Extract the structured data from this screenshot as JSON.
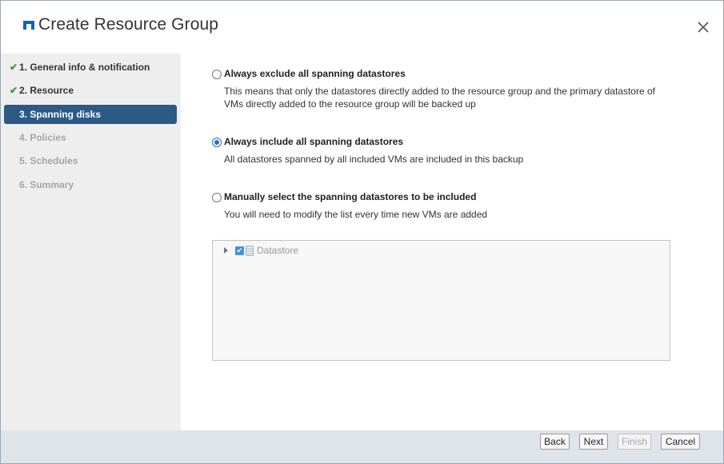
{
  "dialog": {
    "title": "Create Resource Group",
    "logo_icon": "netapp-logo-icon",
    "close_icon": "close-icon",
    "accent_color": "#2b5a87"
  },
  "sidebar": {
    "steps": [
      {
        "label": "1. General info & notification",
        "state": "completed"
      },
      {
        "label": "2. Resource",
        "state": "completed"
      },
      {
        "label": "3. Spanning disks",
        "state": "active"
      },
      {
        "label": "4. Policies",
        "state": "disabled"
      },
      {
        "label": "5. Schedules",
        "state": "disabled"
      },
      {
        "label": "6. Summary",
        "state": "disabled"
      }
    ],
    "check_glyph": "✔"
  },
  "options": [
    {
      "title": "Always exclude all spanning datastores",
      "description": "This means that only the datastores directly added to the resource group and the primary datastore of VMs directly added to the resource group will be backed up",
      "selected": false
    },
    {
      "title": "Always include all spanning datastores",
      "description": "All datastores spanned by all included VMs are included in this backup",
      "selected": true
    },
    {
      "title": "Manually select the spanning datastores to be included",
      "description": "You will need to modify the list every time new VMs are added",
      "selected": false
    }
  ],
  "tree": {
    "items": [
      {
        "label": "Datastore",
        "checked": true,
        "icon": "database-icon",
        "expandable": true
      }
    ],
    "check_glyph": "✔"
  },
  "footer": {
    "back_label": "Back",
    "next_label": "Next",
    "finish_label": "Finish",
    "cancel_label": "Cancel",
    "finish_enabled": false
  }
}
